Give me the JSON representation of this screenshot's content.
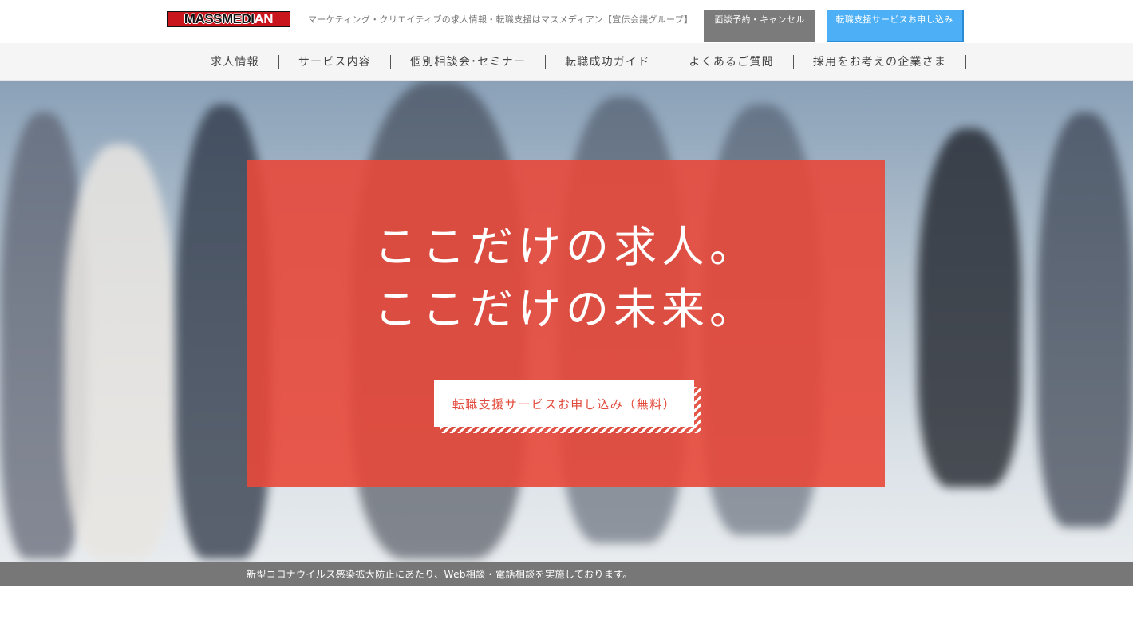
{
  "header": {
    "logo": {
      "part_a": "MASSMEDI",
      "part_b": "AN"
    },
    "tagline": "マーケティング・クリエイティブの求人情報・転職支援はマスメディアン【宣伝会議グループ】",
    "consult_button": "面談予約・キャンセル",
    "apply_button": "転職支援サービスお申し込み"
  },
  "nav": {
    "items": [
      {
        "label": "求人情報"
      },
      {
        "label": "サービス内容"
      },
      {
        "label": "個別相談会･セミナー"
      },
      {
        "label": "転職成功ガイド"
      },
      {
        "label": "よくあるご質問"
      },
      {
        "label": "採用をお考えの企業さま"
      }
    ]
  },
  "hero": {
    "title_line1": "ここだけの求人。",
    "title_line2": "ここだけの未来。",
    "cta_label": "転職支援サービスお申し込み（無料）"
  },
  "notice": {
    "text": "新型コロナウイルス感染拡大防止にあたり、Web相談・電話相談を実施しております。"
  },
  "colors": {
    "brand_red": "#e8483a",
    "apply_blue": "#4db0f6",
    "consult_gray": "#7b7b7b",
    "notice_gray": "#777777"
  }
}
